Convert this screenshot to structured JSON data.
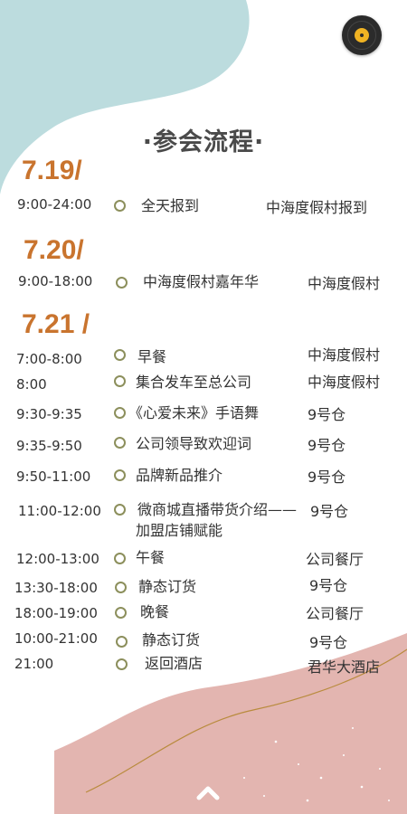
{
  "page": {
    "title": "·参会流程·",
    "colors": {
      "teal_blob": "#bcdcde",
      "pink_blob": "#e3b5b0",
      "date_accent": "#c9742e",
      "dot_ring": "#8c8f5c",
      "gold_line": "#b98b3e"
    },
    "music_icon": "vinyl-record-icon",
    "scroll_icon": "chevron-up-icon"
  },
  "days": [
    {
      "date": "7.19/",
      "items": [
        {
          "time": "9:00-24:00",
          "event": "全天报到",
          "location": "中海度假村报到"
        }
      ]
    },
    {
      "date": "7.20/",
      "items": [
        {
          "time": "9:00-18:00",
          "event": "中海度假村嘉年华",
          "location": "中海度假村"
        }
      ]
    },
    {
      "date": "7.21 /",
      "items": [
        {
          "time": "7:00-8:00",
          "event": "早餐",
          "location": "中海度假村"
        },
        {
          "time": "8:00",
          "event": "集合发车至总公司",
          "location": "中海度假村"
        },
        {
          "time": "9:30-9:35",
          "event": "《心爱未来》手语舞",
          "location": "9号仓"
        },
        {
          "time": "9:35-9:50",
          "event": "公司领导致欢迎词",
          "location": "9号仓"
        },
        {
          "time": "9:50-11:00",
          "event": "品牌新品推介",
          "location": "9号仓"
        },
        {
          "time": "11:00-12:00",
          "event_line1": "微商城直播带货介绍——",
          "event_line2": "加盟店铺赋能",
          "location": "9号仓"
        },
        {
          "time": "12:00-13:00",
          "event": "午餐",
          "location": "公司餐厅"
        },
        {
          "time": "13:30-18:00",
          "event": "静态订货",
          "location": "9号仓"
        },
        {
          "time": "18:00-19:00",
          "event": "晚餐",
          "location": "公司餐厅"
        },
        {
          "time": "10:00-21:00",
          "event": "静态订货",
          "location": "9号仓"
        },
        {
          "time": "21:00",
          "event": "返回酒店",
          "location": "君华大酒店"
        }
      ]
    }
  ]
}
